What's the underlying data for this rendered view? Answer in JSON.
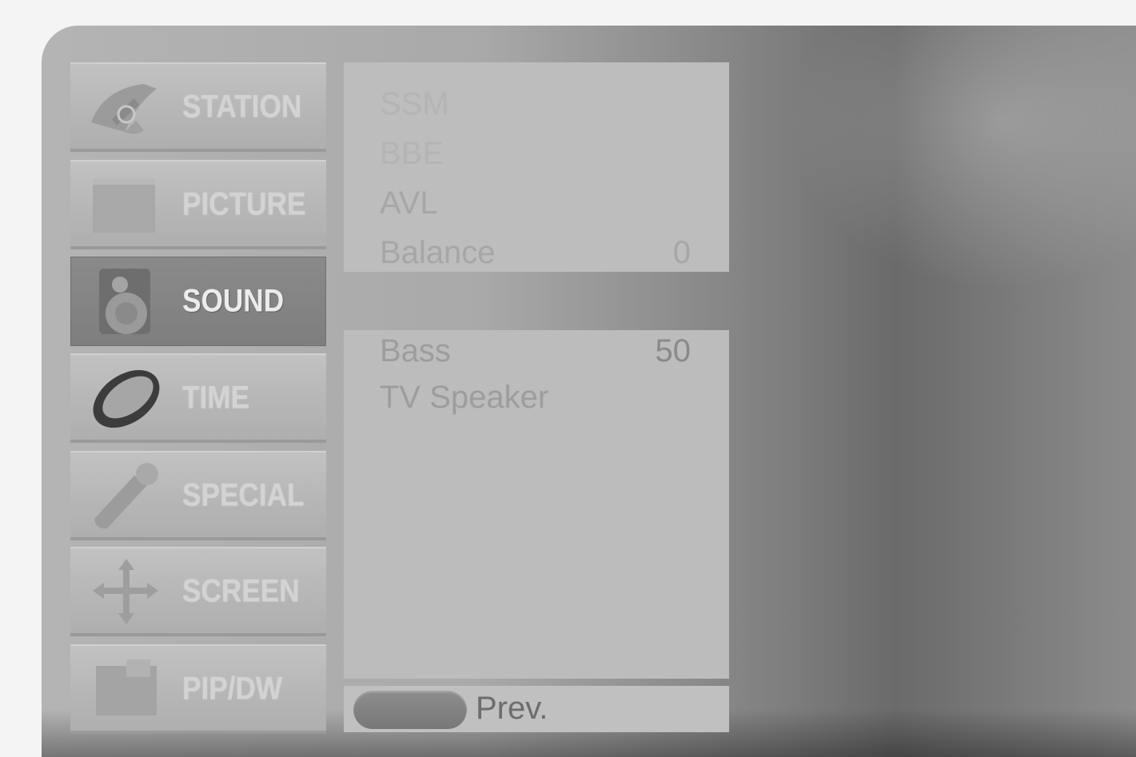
{
  "menu": {
    "items": [
      {
        "label": "STATION",
        "icon": "satellite-dish-icon",
        "active": false
      },
      {
        "label": "PICTURE",
        "icon": "picture-square-icon",
        "active": false
      },
      {
        "label": "SOUND",
        "icon": "speaker-icon",
        "active": true
      },
      {
        "label": "TIME",
        "icon": "clock-ring-icon",
        "active": false
      },
      {
        "label": "SPECIAL",
        "icon": "wrench-icon",
        "active": false
      },
      {
        "label": "SCREEN",
        "icon": "move-arrows-icon",
        "active": false
      },
      {
        "label": "PIP/DW",
        "icon": "pip-window-icon",
        "active": false
      }
    ]
  },
  "sound_panel": {
    "top_options": [
      {
        "label": "SSM",
        "value": ""
      },
      {
        "label": "BBE",
        "value": ""
      },
      {
        "label": "AVL",
        "value": ""
      },
      {
        "label": "Balance",
        "value": "0"
      }
    ],
    "main_options": [
      {
        "label": "Bass",
        "value": "50"
      },
      {
        "label": "TV Speaker",
        "value": ""
      }
    ]
  },
  "footer": {
    "prev_label": "Prev.",
    "prev_button_icon": "pill-button-icon"
  },
  "colors": {
    "frame_light": "#b4b4b4",
    "frame_dark": "#6a6a6a",
    "menu_item": "#b5b5b5",
    "menu_active": "#7e7e7e",
    "panel": "#bdbdbd"
  }
}
